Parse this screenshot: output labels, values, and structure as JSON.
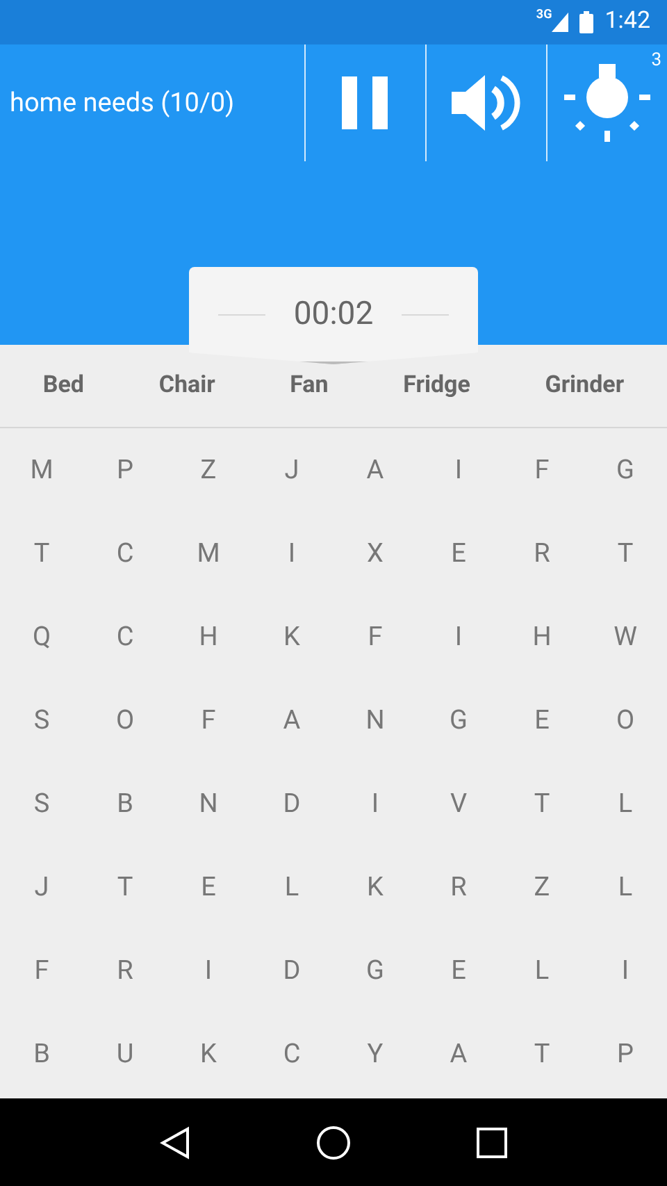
{
  "status_bar": {
    "network": "3G",
    "time": "1:42"
  },
  "toolbar": {
    "title": "home needs (10/0)",
    "hint_count": "3"
  },
  "timer": "00:02",
  "words": [
    "Bed",
    "Chair",
    "Fan",
    "Fridge",
    "Grinder"
  ],
  "grid": [
    [
      "M",
      "P",
      "Z",
      "J",
      "A",
      "I",
      "F",
      "G"
    ],
    [
      "T",
      "C",
      "M",
      "I",
      "X",
      "E",
      "R",
      "T"
    ],
    [
      "Q",
      "C",
      "H",
      "K",
      "F",
      "I",
      "H",
      "W"
    ],
    [
      "S",
      "O",
      "F",
      "A",
      "N",
      "G",
      "E",
      "O"
    ],
    [
      "S",
      "B",
      "N",
      "D",
      "I",
      "V",
      "T",
      "L"
    ],
    [
      "J",
      "T",
      "E",
      "L",
      "K",
      "R",
      "Z",
      "L"
    ],
    [
      "F",
      "R",
      "I",
      "D",
      "G",
      "E",
      "L",
      "I"
    ],
    [
      "B",
      "U",
      "K",
      "C",
      "Y",
      "A",
      "T",
      "P"
    ]
  ]
}
